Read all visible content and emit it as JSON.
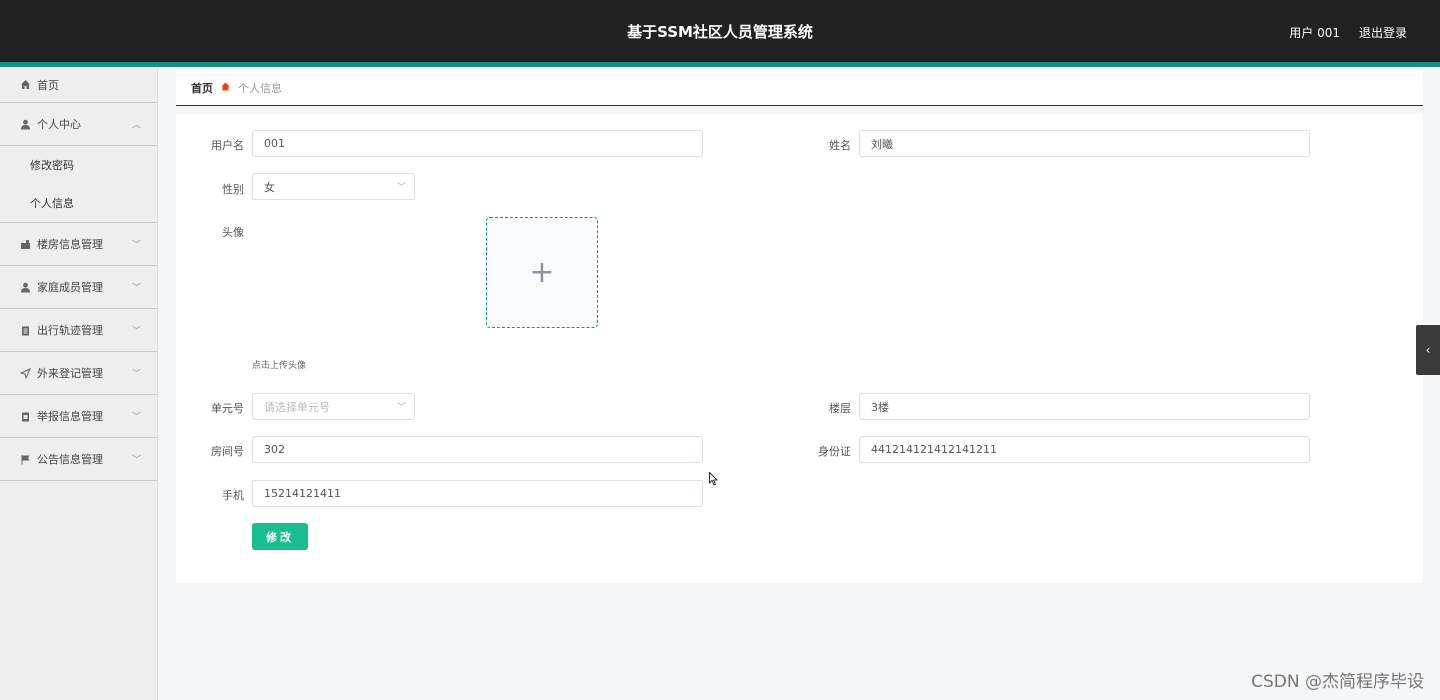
{
  "header": {
    "title": "基于SSM社区人员管理系统",
    "user": "用户 001",
    "logout": "退出登录"
  },
  "sidebar": {
    "home": "首页",
    "personal_center": "个人中心",
    "sub": {
      "change_password": "修改密码",
      "personal_info": "个人信息"
    },
    "items": [
      "楼房信息管理",
      "家庭成员管理",
      "出行轨迹管理",
      "外来登记管理",
      "举报信息管理",
      "公告信息管理"
    ]
  },
  "breadcrumb": {
    "home": "首页",
    "current": "个人信息"
  },
  "form": {
    "username_label": "用户名",
    "username": "001",
    "name_label": "姓名",
    "name": "刘曦",
    "gender_label": "性别",
    "gender": "女",
    "avatar_label": "头像",
    "upload_plus": "+",
    "upload_tip": "点击上传头像",
    "unit_label": "单元号",
    "unit_placeholder": "请选择单元号",
    "floor_label": "楼层",
    "floor": "3楼",
    "room_label": "房间号",
    "room": "302",
    "id_label": "身份证",
    "id_card": "441214121412141211",
    "phone_label": "手机",
    "phone": "15214121411",
    "submit": "修改"
  },
  "watermark": "CSDN @杰简程序毕设",
  "colors": {
    "header_bg": "#222222",
    "accent": "#17907f",
    "button": "#19c08e"
  }
}
